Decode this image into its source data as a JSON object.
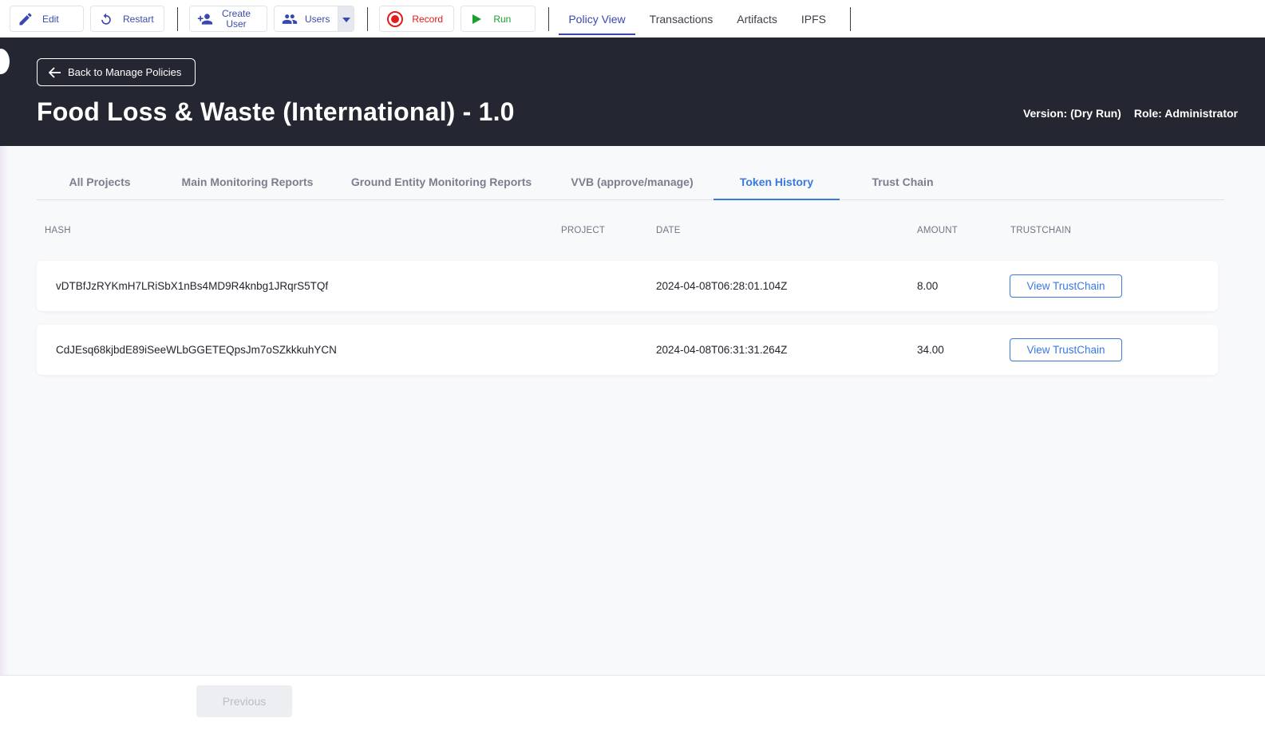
{
  "toolbar": {
    "edit_label": "Edit",
    "restart_label": "Restart",
    "create_user_line1": "Create",
    "create_user_line2": "User",
    "users_label": "Users",
    "record_label": "Record",
    "run_label": "Run",
    "nav": [
      {
        "label": "Policy View",
        "active": true
      },
      {
        "label": "Transactions",
        "active": false
      },
      {
        "label": "Artifacts",
        "active": false
      },
      {
        "label": "IPFS",
        "active": false
      }
    ]
  },
  "header": {
    "back_label": "Back to Manage Policies",
    "title": "Food Loss & Waste (International) - 1.0",
    "version": "Version: (Dry Run)",
    "role": "Role: Administrator"
  },
  "tabs": [
    {
      "label": "All Projects",
      "active": false
    },
    {
      "label": "Main Monitoring Reports",
      "active": false
    },
    {
      "label": "Ground Entity Monitoring Reports",
      "active": false
    },
    {
      "label": "VVB (approve/manage)",
      "active": false
    },
    {
      "label": "Token History",
      "active": true
    },
    {
      "label": "Trust Chain",
      "active": false
    }
  ],
  "table": {
    "columns": {
      "hash": "HASH",
      "project": "PROJECT",
      "date": "DATE",
      "amount": "AMOUNT",
      "trustchain": "TRUSTCHAIN"
    },
    "rows": [
      {
        "hash": "vDTBfJzRYKmH7LRiSbX1nBs4MD9R4knbg1JRqrS5TQf",
        "project": "",
        "date": "2024-04-08T06:28:01.104Z",
        "amount": "8.00",
        "action": "View TrustChain"
      },
      {
        "hash": "CdJEsq68kjbdE89iSeeWLbGGETEQpsJm7oSZkkkuhYCN",
        "project": "",
        "date": "2024-04-08T06:31:31.264Z",
        "amount": "34.00",
        "action": "View TrustChain"
      }
    ]
  },
  "footer": {
    "previous_label": "Previous"
  },
  "colors": {
    "toolbar_accent": "#3848b0",
    "header_bg": "#242631",
    "tab_active": "#3a7ae0",
    "record": "#e21b1b",
    "run": "#1a9e2c"
  }
}
